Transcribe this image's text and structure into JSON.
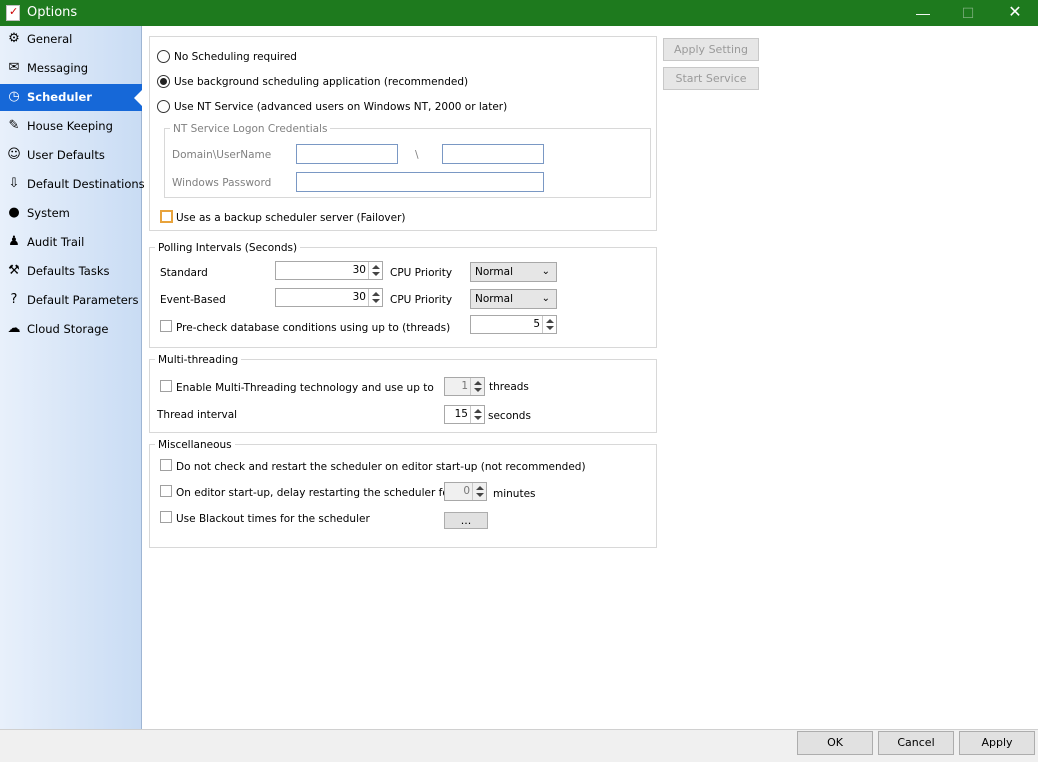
{
  "window": {
    "title": "Options"
  },
  "sidebar": {
    "items": [
      {
        "label": "General",
        "icon": "general-icon"
      },
      {
        "label": "Messaging",
        "icon": "messaging-icon"
      },
      {
        "label": "Scheduler",
        "icon": "scheduler-icon",
        "active": true
      },
      {
        "label": "House Keeping",
        "icon": "housekeeping-icon"
      },
      {
        "label": "User Defaults",
        "icon": "users-icon"
      },
      {
        "label": "Default Destinations",
        "icon": "destinations-icon"
      },
      {
        "label": "System",
        "icon": "globe-icon"
      },
      {
        "label": "Audit Trail",
        "icon": "audit-icon"
      },
      {
        "label": "Defaults Tasks",
        "icon": "tasks-icon"
      },
      {
        "label": "Default Parameters",
        "icon": "help-icon"
      },
      {
        "label": "Cloud Storage",
        "icon": "cloud-icon"
      }
    ]
  },
  "scheduling": {
    "option_none": "No Scheduling required",
    "option_background": "Use background scheduling application (recommended)",
    "option_nt": "Use NT Service (advanced users on Windows NT, 2000 or later)",
    "selected": "background",
    "credentials": {
      "title": "NT Service Logon Credentials",
      "domain_label": "Domain\\UserName",
      "separator": "\\",
      "password_label": "Windows Password"
    },
    "backup_label": "Use as a backup scheduler server (Failover)"
  },
  "actions": {
    "apply_setting": "Apply Setting",
    "start_service": "Start Service"
  },
  "polling": {
    "title": "Polling Intervals (Seconds)",
    "standard_label": "Standard",
    "standard_value": "30",
    "event_label": "Event-Based",
    "event_value": "30",
    "cpu_label": "CPU Priority",
    "cpu_standard": "Normal",
    "cpu_event": "Normal",
    "precheck_label": "Pre-check database conditions using up to (threads)",
    "precheck_value": "5"
  },
  "multithreading": {
    "title": "Multi-threading",
    "enable_label": "Enable Multi-Threading technology and use up to",
    "threads_value": "1",
    "threads_unit": "threads",
    "interval_label": "Thread interval",
    "interval_value": "15",
    "interval_unit": "seconds"
  },
  "misc": {
    "title": "Miscellaneous",
    "no_restart_label": "Do not check and restart the scheduler on editor start-up (not recommended)",
    "delay_label": "On editor start-up, delay restarting the scheduler for",
    "delay_value": "0",
    "delay_unit": "minutes",
    "blackout_label": "Use Blackout times for the scheduler",
    "blackout_button": "..."
  },
  "footer": {
    "ok": "OK",
    "cancel": "Cancel",
    "apply": "Apply"
  },
  "colors": {
    "titlebar": "#1e7a1e",
    "active_item": "#1668d8",
    "sidebar": "#d6e4f7"
  }
}
